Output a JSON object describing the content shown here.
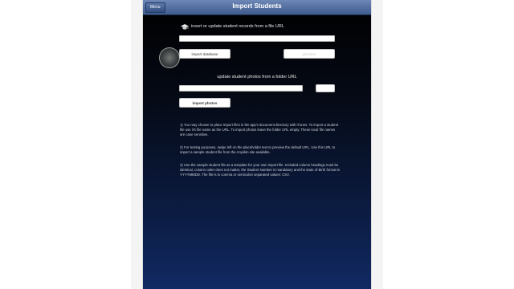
{
  "navbar": {
    "title": "Import Students",
    "menu_label": "Menu"
  },
  "file_section": {
    "label": "insert or update student records from a file URL",
    "url_placeholder": "",
    "import_button": "import database",
    "preview_button": "preview"
  },
  "photo_section": {
    "label": "update student photos from a folder URL",
    "url_placeholder": "",
    "small_button": "",
    "import_button": "import photos"
  },
  "notes": [
    "1) You may choose to place import files in the app's document directory with iTunes. To import a student file use it's file name as the URL. To import photos leave the folder URL empty. These local file names are case sensitive.",
    "2) For testing purposes, swipe left on the placeholder text to preview the default URL. Use this URL to import a sample student file from the Anyskin site available.",
    "3) Use the sample student file as a template for your own import file. Included column headings must be identical, column order does not matter, the Student Number is mandatory and the Date of Birth format is YYYYMMDD. The file is in comma or semicolon separated values: CSV."
  ],
  "colors": {
    "navbar_top": "#6d87b6",
    "navbar_bottom": "#3e5b8e",
    "background_bottom": "#112a63"
  },
  "icons": {
    "section_icon": "graduation-cap-icon"
  }
}
